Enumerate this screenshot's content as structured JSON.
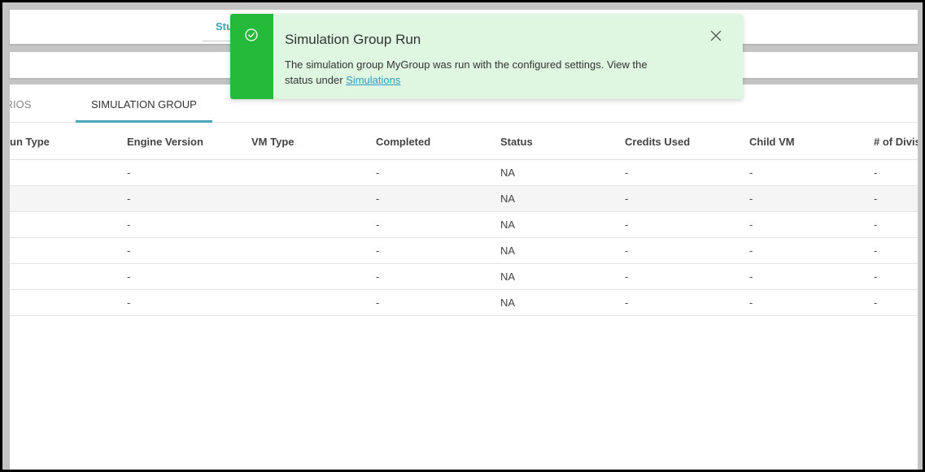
{
  "top_tab": {
    "label": "Stu"
  },
  "tabs": [
    {
      "label": "ARIOS"
    },
    {
      "label": "SIMULATION GROUP"
    }
  ],
  "table": {
    "columns": [
      "un Type",
      "Engine Version",
      "VM Type",
      "Completed",
      "Status",
      "Credits Used",
      "Child VM",
      "# of Divis"
    ],
    "rows": [
      [
        "",
        "-",
        "",
        "-",
        "NA",
        "-",
        "-",
        "-"
      ],
      [
        "",
        "-",
        "",
        "-",
        "NA",
        "-",
        "-",
        "-"
      ],
      [
        "",
        "-",
        "",
        "-",
        "NA",
        "-",
        "-",
        "-"
      ],
      [
        "",
        "-",
        "",
        "-",
        "NA",
        "-",
        "-",
        "-"
      ],
      [
        "",
        "-",
        "",
        "-",
        "NA",
        "-",
        "-",
        "-"
      ],
      [
        "",
        "-",
        "",
        "-",
        "NA",
        "-",
        "-",
        "-"
      ]
    ]
  },
  "toast": {
    "title": "Simulation Group Run",
    "message": "The simulation group MyGroup was run with the configured settings. View the status under ",
    "link": "Simulations",
    "icon": "check-circle-icon",
    "accent_color": "#26ba3b",
    "background_color": "#dff6e1"
  }
}
